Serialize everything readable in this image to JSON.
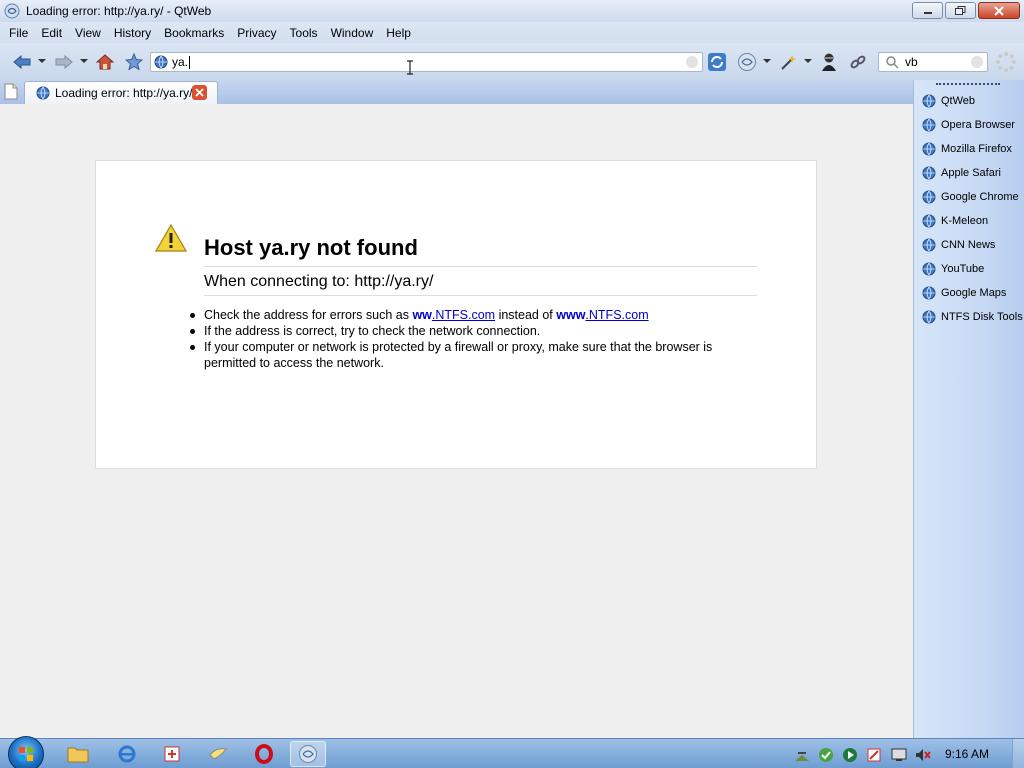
{
  "window": {
    "title": "Loading error: http://ya.ry/ - QtWeb",
    "controls": [
      "minimize",
      "maximize",
      "close"
    ]
  },
  "menu": [
    "File",
    "Edit",
    "View",
    "History",
    "Bookmarks",
    "Privacy",
    "Tools",
    "Window",
    "Help"
  ],
  "toolbar": {
    "address_value": "ya.",
    "search_value": "vb"
  },
  "tabs": [
    {
      "label": "Loading error: http://ya.ry/"
    }
  ],
  "error_page": {
    "title": "Host ya.ry not found",
    "subtitle": "When connecting to: http://ya.ry/",
    "bullet1_pre": "Check the address for errors such as ",
    "bullet1_bad_prefix": "ww",
    "bullet1_bad_link": ".NTFS.com",
    "bullet1_mid": " instead of ",
    "bullet1_good_prefix": "www",
    "bullet1_good_link": ".NTFS.com",
    "bullet2": "If the address is correct, try to check the network connection.",
    "bullet3": "If your computer or network is protected by a firewall or proxy, make sure that the browser is permitted to access the network."
  },
  "sidebar": {
    "items": [
      {
        "label": "QtWeb"
      },
      {
        "label": "Opera Browser"
      },
      {
        "label": "Mozilla Firefox"
      },
      {
        "label": "Apple Safari"
      },
      {
        "label": "Google Chrome"
      },
      {
        "label": "K-Meleon"
      },
      {
        "label": "CNN News"
      },
      {
        "label": "YouTube"
      },
      {
        "label": "Google Maps"
      },
      {
        "label": "NTFS Disk Tools"
      }
    ]
  },
  "taskbar": {
    "clock": "9:16 AM"
  },
  "colors": {
    "link": "#0000cc",
    "tab_close": "#d8532f",
    "window_close": "#c9452a"
  }
}
